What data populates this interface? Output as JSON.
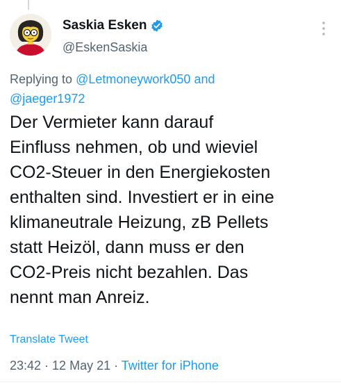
{
  "author": {
    "display_name": "Saskia Esken",
    "handle": "@EskenSaskia",
    "verified_icon": "verified-badge-icon",
    "avatar_icon": "cartoon-avatar"
  },
  "reply": {
    "prefix": "Replying to",
    "mention_1": "@Letmoneywork050",
    "conjunction": "and",
    "mention_2": "@jaeger1972"
  },
  "tweet": {
    "text": "Der Vermieter kann darauf\nEinfluss nehmen, ob und wieviel\nCO2-Steuer in den Energiekosten\nenthalten sind. Investiert er in eine\nklimaneutrale Heizung, zB Pellets\nstatt Heizöl, dann muss er den\nCO2-Preis nicht bezahlen. Das\nnennt man Anreiz."
  },
  "actions": {
    "translate_label": "Translate Tweet",
    "more_icon": "more-vertical-icon"
  },
  "meta": {
    "time": "23:42",
    "separator_1": " · ",
    "date": "12 May 21",
    "separator_2": " · ",
    "source": "Twitter for iPhone"
  },
  "colors": {
    "accent": "#1d9bf0",
    "text_primary": "#0f1419",
    "text_secondary": "#536471"
  }
}
